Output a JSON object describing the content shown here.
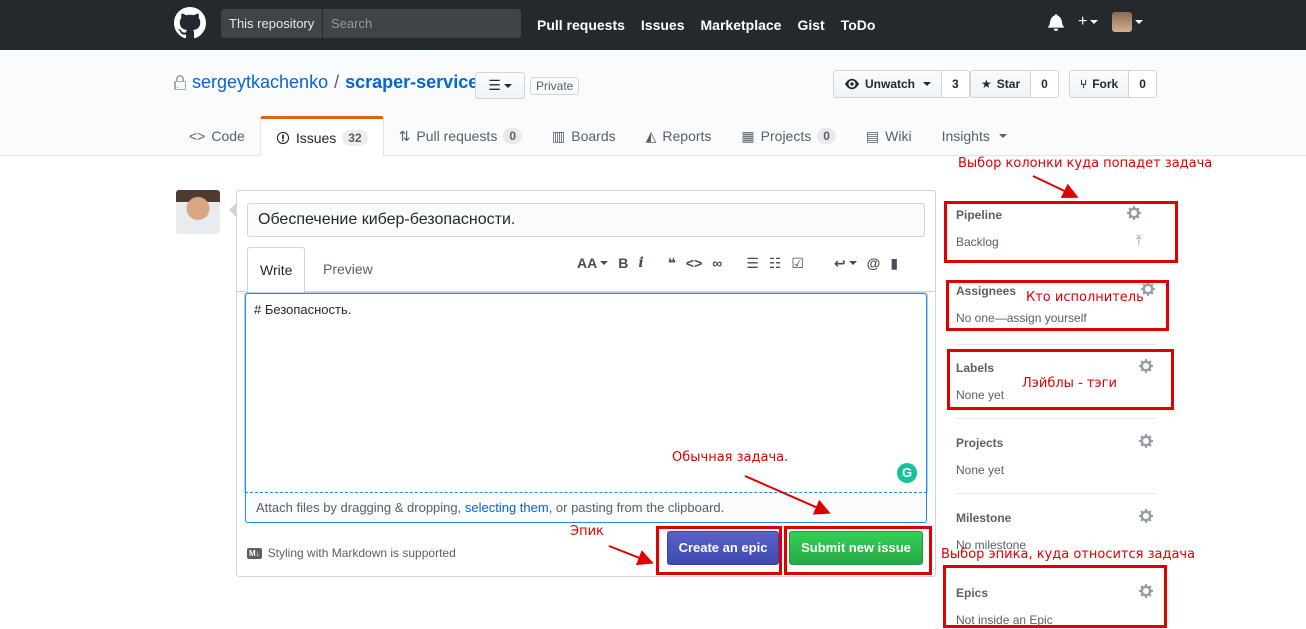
{
  "topbar": {
    "search_scope": "This repository",
    "search_placeholder": "Search",
    "nav": [
      "Pull requests",
      "Issues",
      "Marketplace",
      "Gist",
      "ToDo"
    ],
    "bg_color": "#24292e"
  },
  "repo": {
    "owner": "sergeytkachenko",
    "separator": "/",
    "name": "scraper-service",
    "visibility": "Private",
    "watch_label": "Unwatch",
    "watch_count": "3",
    "star_label": "Star",
    "star_count": "0",
    "fork_label": "Fork",
    "fork_count": "0"
  },
  "tabs": [
    {
      "label": "Code",
      "icon": "code-icon"
    },
    {
      "label": "Issues",
      "icon": "issue-icon",
      "count": "32",
      "selected": true
    },
    {
      "label": "Pull requests",
      "icon": "pull-request-icon",
      "count": "0"
    },
    {
      "label": "Boards",
      "icon": "boards-icon"
    },
    {
      "label": "Reports",
      "icon": "reports-icon"
    },
    {
      "label": "Projects",
      "icon": "projects-icon",
      "count": "0"
    },
    {
      "label": "Wiki",
      "icon": "wiki-icon"
    },
    {
      "label": "Insights",
      "icon": "chevron-down-icon"
    }
  ],
  "issue_form": {
    "title_value": "Обеспечение кибер-безопасности.",
    "write_tab": "Write",
    "preview_tab": "Preview",
    "body_text": "# Безопасность.",
    "attach_prefix": "Attach files by dragging & dropping, ",
    "attach_link": "selecting them",
    "attach_suffix": ", or pasting from the clipboard.",
    "markdown_badge": "M↓",
    "markdown_note": "Styling with Markdown is supported",
    "create_epic_label": "Create an epic",
    "submit_label": "Submit new issue",
    "grammarly_letter": "G"
  },
  "sidebar": {
    "pipeline": {
      "heading": "Pipeline",
      "value": "Backlog"
    },
    "assignees": {
      "heading": "Assignees",
      "value": "No one—assign yourself"
    },
    "labels": {
      "heading": "Labels",
      "value": "None yet"
    },
    "projects": {
      "heading": "Projects",
      "value": "None yet"
    },
    "milestone": {
      "heading": "Milestone",
      "value": "No milestone"
    },
    "epics": {
      "heading": "Epics",
      "value": "Not inside an Epic"
    }
  },
  "annotations": {
    "pipeline": "Выбор колонки куда попадет задача",
    "assignees": "Кто исполнитель",
    "labels": "Лэйблы - тэги",
    "regular_task": "Обычная задача.",
    "epic": "Эпик",
    "epics": "Выбор эпика, куда относится задача",
    "color": "#e00000"
  },
  "colors": {
    "link": "#0366d6",
    "submit_green": "#28a745",
    "epic_blue": "#3f49b1",
    "selected_tab_accent": "#e36209"
  }
}
